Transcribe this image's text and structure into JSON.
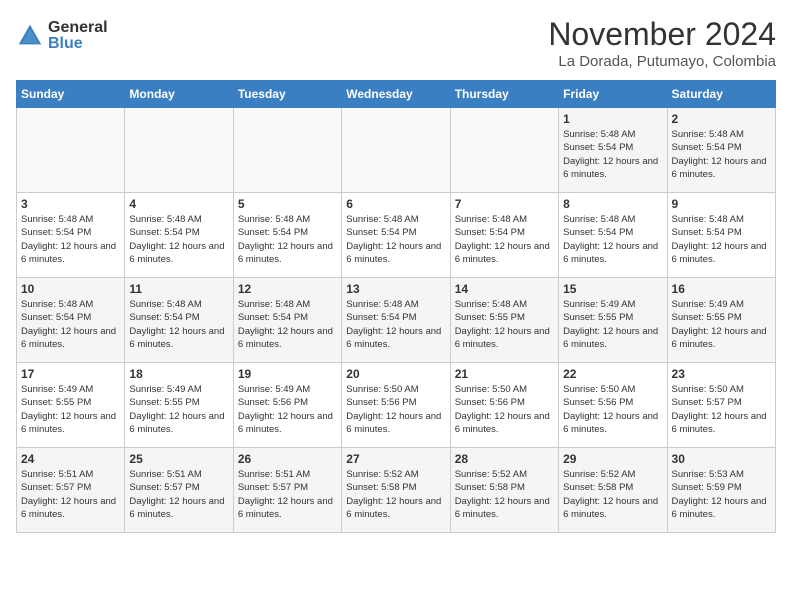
{
  "header": {
    "logo_general": "General",
    "logo_blue": "Blue",
    "month_title": "November 2024",
    "location": "La Dorada, Putumayo, Colombia"
  },
  "calendar": {
    "days_of_week": [
      "Sunday",
      "Monday",
      "Tuesday",
      "Wednesday",
      "Thursday",
      "Friday",
      "Saturday"
    ],
    "weeks": [
      [
        {
          "day": "",
          "info": ""
        },
        {
          "day": "",
          "info": ""
        },
        {
          "day": "",
          "info": ""
        },
        {
          "day": "",
          "info": ""
        },
        {
          "day": "",
          "info": ""
        },
        {
          "day": "1",
          "info": "Sunrise: 5:48 AM\nSunset: 5:54 PM\nDaylight: 12 hours and 6 minutes."
        },
        {
          "day": "2",
          "info": "Sunrise: 5:48 AM\nSunset: 5:54 PM\nDaylight: 12 hours and 6 minutes."
        }
      ],
      [
        {
          "day": "3",
          "info": "Sunrise: 5:48 AM\nSunset: 5:54 PM\nDaylight: 12 hours and 6 minutes."
        },
        {
          "day": "4",
          "info": "Sunrise: 5:48 AM\nSunset: 5:54 PM\nDaylight: 12 hours and 6 minutes."
        },
        {
          "day": "5",
          "info": "Sunrise: 5:48 AM\nSunset: 5:54 PM\nDaylight: 12 hours and 6 minutes."
        },
        {
          "day": "6",
          "info": "Sunrise: 5:48 AM\nSunset: 5:54 PM\nDaylight: 12 hours and 6 minutes."
        },
        {
          "day": "7",
          "info": "Sunrise: 5:48 AM\nSunset: 5:54 PM\nDaylight: 12 hours and 6 minutes."
        },
        {
          "day": "8",
          "info": "Sunrise: 5:48 AM\nSunset: 5:54 PM\nDaylight: 12 hours and 6 minutes."
        },
        {
          "day": "9",
          "info": "Sunrise: 5:48 AM\nSunset: 5:54 PM\nDaylight: 12 hours and 6 minutes."
        }
      ],
      [
        {
          "day": "10",
          "info": "Sunrise: 5:48 AM\nSunset: 5:54 PM\nDaylight: 12 hours and 6 minutes."
        },
        {
          "day": "11",
          "info": "Sunrise: 5:48 AM\nSunset: 5:54 PM\nDaylight: 12 hours and 6 minutes."
        },
        {
          "day": "12",
          "info": "Sunrise: 5:48 AM\nSunset: 5:54 PM\nDaylight: 12 hours and 6 minutes."
        },
        {
          "day": "13",
          "info": "Sunrise: 5:48 AM\nSunset: 5:54 PM\nDaylight: 12 hours and 6 minutes."
        },
        {
          "day": "14",
          "info": "Sunrise: 5:48 AM\nSunset: 5:55 PM\nDaylight: 12 hours and 6 minutes."
        },
        {
          "day": "15",
          "info": "Sunrise: 5:49 AM\nSunset: 5:55 PM\nDaylight: 12 hours and 6 minutes."
        },
        {
          "day": "16",
          "info": "Sunrise: 5:49 AM\nSunset: 5:55 PM\nDaylight: 12 hours and 6 minutes."
        }
      ],
      [
        {
          "day": "17",
          "info": "Sunrise: 5:49 AM\nSunset: 5:55 PM\nDaylight: 12 hours and 6 minutes."
        },
        {
          "day": "18",
          "info": "Sunrise: 5:49 AM\nSunset: 5:55 PM\nDaylight: 12 hours and 6 minutes."
        },
        {
          "day": "19",
          "info": "Sunrise: 5:49 AM\nSunset: 5:56 PM\nDaylight: 12 hours and 6 minutes."
        },
        {
          "day": "20",
          "info": "Sunrise: 5:50 AM\nSunset: 5:56 PM\nDaylight: 12 hours and 6 minutes."
        },
        {
          "day": "21",
          "info": "Sunrise: 5:50 AM\nSunset: 5:56 PM\nDaylight: 12 hours and 6 minutes."
        },
        {
          "day": "22",
          "info": "Sunrise: 5:50 AM\nSunset: 5:56 PM\nDaylight: 12 hours and 6 minutes."
        },
        {
          "day": "23",
          "info": "Sunrise: 5:50 AM\nSunset: 5:57 PM\nDaylight: 12 hours and 6 minutes."
        }
      ],
      [
        {
          "day": "24",
          "info": "Sunrise: 5:51 AM\nSunset: 5:57 PM\nDaylight: 12 hours and 6 minutes."
        },
        {
          "day": "25",
          "info": "Sunrise: 5:51 AM\nSunset: 5:57 PM\nDaylight: 12 hours and 6 minutes."
        },
        {
          "day": "26",
          "info": "Sunrise: 5:51 AM\nSunset: 5:57 PM\nDaylight: 12 hours and 6 minutes."
        },
        {
          "day": "27",
          "info": "Sunrise: 5:52 AM\nSunset: 5:58 PM\nDaylight: 12 hours and 6 minutes."
        },
        {
          "day": "28",
          "info": "Sunrise: 5:52 AM\nSunset: 5:58 PM\nDaylight: 12 hours and 6 minutes."
        },
        {
          "day": "29",
          "info": "Sunrise: 5:52 AM\nSunset: 5:58 PM\nDaylight: 12 hours and 6 minutes."
        },
        {
          "day": "30",
          "info": "Sunrise: 5:53 AM\nSunset: 5:59 PM\nDaylight: 12 hours and 6 minutes."
        }
      ]
    ]
  }
}
